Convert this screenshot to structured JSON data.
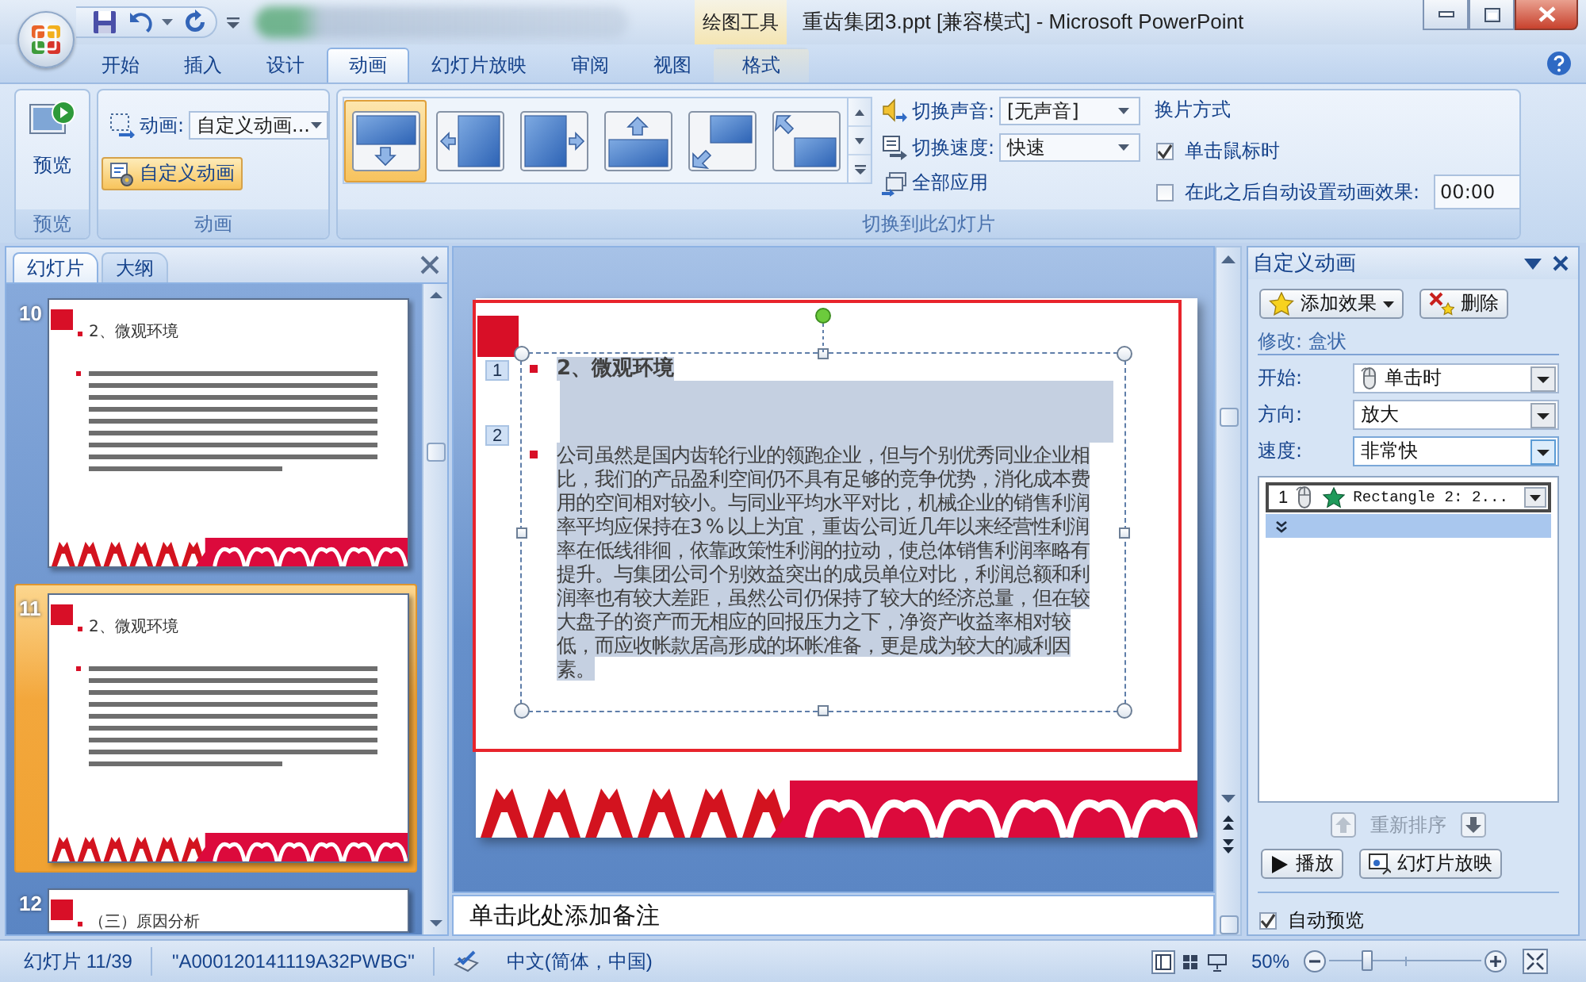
{
  "title_bar": {
    "context_tab": "绘图工具",
    "title": "重齿集团3.ppt [兼容模式] - Microsoft PowerPoint"
  },
  "ribbon_tabs": [
    {
      "label": "开始",
      "selected": false,
      "kind": "standard"
    },
    {
      "label": "插入",
      "selected": false,
      "kind": "standard"
    },
    {
      "label": "设计",
      "selected": false,
      "kind": "standard"
    },
    {
      "label": "动画",
      "selected": true,
      "kind": "standard"
    },
    {
      "label": "幻灯片放映",
      "selected": false,
      "kind": "standard"
    },
    {
      "label": "审阅",
      "selected": false,
      "kind": "standard"
    },
    {
      "label": "视图",
      "selected": false,
      "kind": "standard"
    },
    {
      "label": "格式",
      "selected": false,
      "kind": "contextual"
    }
  ],
  "ribbon": {
    "preview": {
      "button": "预览",
      "group_label": "预览"
    },
    "animations": {
      "label": "动画:",
      "value": "自定义动画...",
      "custom_button": {
        "label": "自定义动画",
        "active": true
      },
      "group_label": "动画"
    },
    "transition": {
      "gallery": [
        {
          "selected": true
        },
        {
          "selected": false
        },
        {
          "selected": false
        },
        {
          "selected": false
        },
        {
          "selected": false
        },
        {
          "selected": false
        }
      ],
      "sound": {
        "label": "切换声音:",
        "value": "[无声音]"
      },
      "speed": {
        "label": "切换速度:",
        "value": "快速"
      },
      "apply_all": "全部应用",
      "advance": {
        "title": "换片方式",
        "on_click": {
          "label": "单击鼠标时",
          "checked": true
        },
        "after": {
          "label": "在此之后自动设置动画效果:",
          "checked": false,
          "value": "00:00"
        }
      },
      "group_label": "切换到此幻灯片"
    }
  },
  "slides_pane": {
    "tabs": [
      {
        "label": "幻灯片",
        "selected": true
      },
      {
        "label": "大纲",
        "selected": false
      }
    ],
    "thumbnails": [
      {
        "number": "10",
        "title": "2、微观环境",
        "kind": "title_body",
        "selected": false
      },
      {
        "number": "11",
        "title": "2、微观环境",
        "kind": "title_body",
        "selected": true
      },
      {
        "number": "12",
        "title": "（三）原因分析",
        "kind": "title",
        "selected": false
      }
    ]
  },
  "slide": {
    "text_selected": true,
    "paragraphs": [
      {
        "kind": "heading",
        "tag": "1",
        "text": "2、微观环境"
      },
      {
        "kind": "body",
        "tag": "2",
        "text": "公司虽然是国内齿轮行业的领跑企业，但与个别优秀同业企业相比，我们的产品盈利空间仍不具有足够的竞争优势，消化成本费用的空间相对较小。与同业平均水平对比，机械企业的销售利润率平均应保持在3%以上为宜，重齿公司近几年以来经营性利润率在低线徘徊，依靠政策性利润的拉动，使总体销售利润率略有提升。与集团公司个别效益突出的成员单位对比，利润总额和利润率也有较大差距，虽然公司仍保持了较大的经济总量，但在较大盘子的资产而无相应的回报压力之下，净资产收益率相对较低，而应收帐款居高形成的坏帐准备，更是成为较大的减利因素。"
      }
    ]
  },
  "notes": {
    "placeholder": "单击此处添加备注"
  },
  "custom_animation": {
    "title": "自定义动画",
    "add_effect": "添加效果",
    "remove": "删除",
    "modify": "修改: 盒状",
    "fields": [
      {
        "label": "开始:",
        "value": "单击时",
        "kind": "trigger",
        "focused": false
      },
      {
        "label": "方向:",
        "value": "放大",
        "kind": "plain",
        "focused": false
      },
      {
        "label": "速度:",
        "value": "非常快",
        "kind": "plain",
        "focused": true
      }
    ],
    "effects": [
      {
        "order": "1",
        "name": "Rectangle 2: 2...",
        "selected": true
      }
    ],
    "reorder": {
      "label": "重新排序",
      "up_disabled": true,
      "down_disabled": false
    },
    "play": "播放",
    "slide_show": "幻灯片放映",
    "auto_preview": {
      "label": "自动预览",
      "checked": true
    }
  },
  "status_bar": {
    "slide": "幻灯片 11/39",
    "theme": "\"A000120141119A32PWBG\"",
    "language": "中文(简体，中国)",
    "views": [
      {
        "selected": true
      },
      {
        "selected": false
      },
      {
        "selected": false
      }
    ],
    "zoom": "50%",
    "zoom_slider": {
      "level": 0.25
    }
  }
}
